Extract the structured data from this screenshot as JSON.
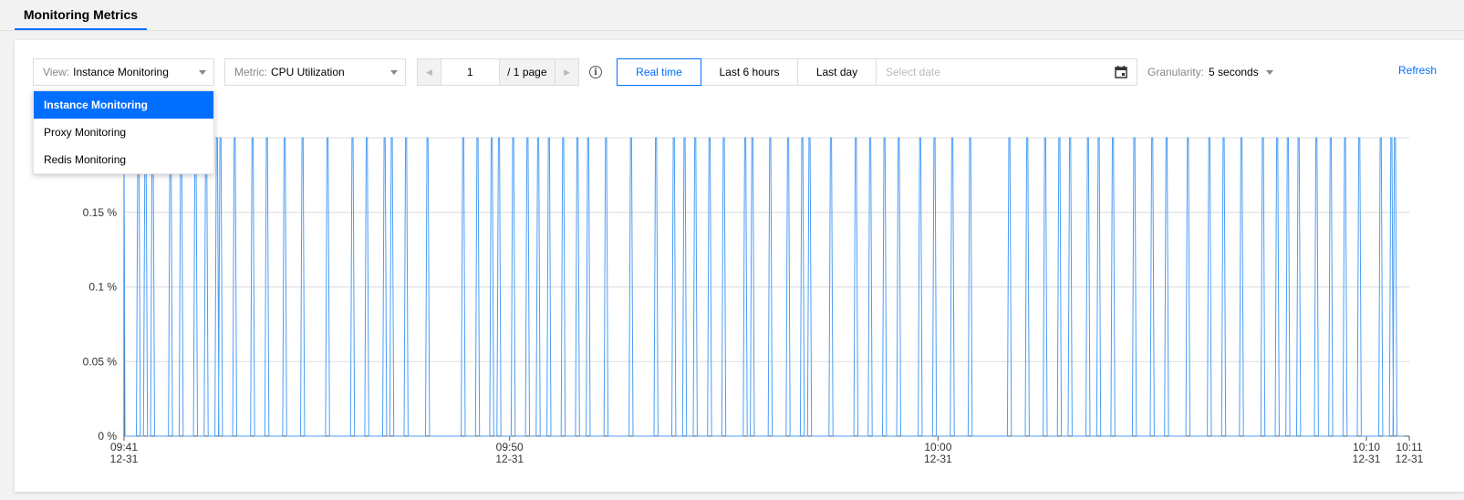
{
  "tab": {
    "label": "Monitoring Metrics"
  },
  "toolbar": {
    "view": {
      "label": "View:",
      "value": "Instance Monitoring"
    },
    "metric": {
      "label": "Metric:",
      "value": "CPU Utilization"
    },
    "pager": {
      "page": "1",
      "total": "/ 1 page",
      "prev": "◀",
      "next": "▶"
    },
    "info_icon": "info-icon",
    "time_buttons": [
      "Real time",
      "Last 6 hours",
      "Last day"
    ],
    "date_placeholder": "Select date",
    "granularity": {
      "label": "Granularity:",
      "value": "5 seconds"
    },
    "refresh": "Refresh"
  },
  "dropdown": {
    "options": [
      "Instance Monitoring",
      "Proxy Monitoring",
      "Redis Monitoring"
    ],
    "selected_index": 0
  },
  "colors": {
    "accent": "#006eff",
    "line": "#4c9df5",
    "grid": "#dcdcdc"
  },
  "chart_data": {
    "type": "line",
    "series": [
      {
        "values": [
          0,
          0.2
        ]
      }
    ],
    "ylim": [
      0,
      0.2
    ],
    "y_ticks": [
      {
        "value": 0,
        "label": "0 %"
      },
      {
        "value": 0.05,
        "label": "0.05 %"
      },
      {
        "value": 0.1,
        "label": "0.1 %"
      },
      {
        "value": 0.15,
        "label": "0.15 %"
      }
    ],
    "x_ticks": [
      {
        "time": "09:41",
        "date": "12-31"
      },
      {
        "time": "09:50",
        "date": "12-31"
      },
      {
        "time": "10:00",
        "date": "12-31"
      },
      {
        "time": "10:10",
        "date": "12-31"
      },
      {
        "time": "10:11",
        "date": "12-31"
      }
    ],
    "spike_times": [
      "09:41:20",
      "09:41:30",
      "09:41:40",
      "09:42:05",
      "09:42:20",
      "09:42:40",
      "09:42:55",
      "09:43:10",
      "09:43:15",
      "09:43:35",
      "09:44:00",
      "09:44:20",
      "09:44:45",
      "09:45:10",
      "09:45:45",
      "09:46:20",
      "09:46:40",
      "09:47:05",
      "09:47:15",
      "09:47:35",
      "09:48:05",
      "09:48:55",
      "09:49:15",
      "09:49:35",
      "09:49:45",
      "09:50:05",
      "09:50:25",
      "09:50:40",
      "09:50:55",
      "09:51:15",
      "09:51:35",
      "09:51:50",
      "09:52:15",
      "09:52:50",
      "09:53:25",
      "09:53:50",
      "09:54:05",
      "09:54:20",
      "09:54:40",
      "09:55:00",
      "09:55:30",
      "09:55:40",
      "09:56:05",
      "09:56:30",
      "09:56:50",
      "09:57:00",
      "09:57:30",
      "09:58:05",
      "09:58:25",
      "09:58:45",
      "09:59:05",
      "09:59:35",
      "09:59:55",
      "10:00:20",
      "10:00:45",
      "10:01:40",
      "10:02:05",
      "10:02:30",
      "10:02:50",
      "10:03:05",
      "10:03:30",
      "10:03:45",
      "10:04:05",
      "10:04:35",
      "10:05:00",
      "10:05:20",
      "10:05:50",
      "10:06:20",
      "10:06:40",
      "10:07:05",
      "10:07:35",
      "10:07:55",
      "10:08:10",
      "10:08:25",
      "10:08:50",
      "10:09:10",
      "10:09:30",
      "10:09:50",
      "10:10:20",
      "10:10:35",
      "10:10:40"
    ]
  }
}
